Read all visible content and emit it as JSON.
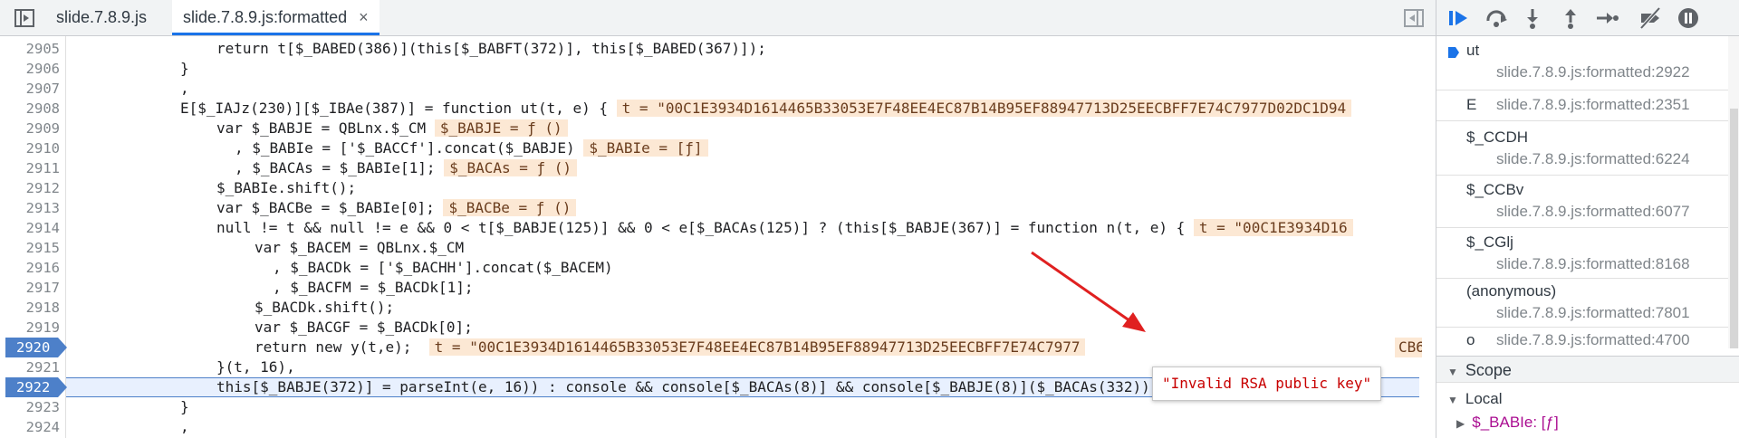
{
  "tabs": [
    {
      "label": "slide.7.8.9.js",
      "active": false
    },
    {
      "label": "slide.7.8.9.js:formatted",
      "active": true,
      "close": "×"
    }
  ],
  "icons": {
    "sidebar_toggle": "sidebar-toggle-icon",
    "panel_toggle": "panel-toggle-icon"
  },
  "code_lines": [
    {
      "no": "2905",
      "text": "return t[$_BABED(386)](this[$_BABFT(372)], this[$_BABED(367)]);"
    },
    {
      "no": "2906",
      "text": "}"
    },
    {
      "no": "2907",
      "text": ","
    },
    {
      "no": "2908",
      "text": "E[$_IAJz(230)][$_IBAe(387)] = function ut(t, e) {"
    },
    {
      "no": "2909",
      "text": "var $_BABJE = QBLnx.$_CM"
    },
    {
      "no": "2910",
      "text": ", $_BABIe = ['$_BACCf'].concat($_BABJE)"
    },
    {
      "no": "2911",
      "text": ", $_BACAs = $_BABIe[1];"
    },
    {
      "no": "2912",
      "text": "$_BABIe.shift();"
    },
    {
      "no": "2913",
      "text": "var $_BACBe = $_BABIe[0];"
    },
    {
      "no": "2914",
      "text": "null != t && null != e && 0 < t[$_BABJE(125)] && 0 < e[$_BACAs(125)] ? (this[$_BABJE(367)] = function n(t, e) {"
    },
    {
      "no": "2915",
      "text": "var $_BACEM = QBLnx.$_CM"
    },
    {
      "no": "2916",
      "text": ", $_BACDk = ['$_BACHH'].concat($_BACEM)"
    },
    {
      "no": "2917",
      "text": ", $_BACFM = $_BACDk[1];"
    },
    {
      "no": "2918",
      "text": "$_BACDk.shift();"
    },
    {
      "no": "2919",
      "text": "var $_BACGF = $_BACDk[0];"
    },
    {
      "no": "2920",
      "text": "return new y(t,e);"
    },
    {
      "no": "2921",
      "text": "}(t, 16),"
    },
    {
      "no": "2922",
      "text": "this[$_BABJE(372)] = parseInt(e, 16)) : console && console[$_BACAs(8)] && console[$_BABJE(8)]($_BACAs(332));"
    },
    {
      "no": "2923",
      "text": "}"
    },
    {
      "no": "2924",
      "text": ","
    }
  ],
  "inline_values": {
    "l2908": "t = \"00C1E3934D1614465B33053E7F48EE4EC87B14B95EF88947713D25EECBFF7E74C7977D02DC1D94",
    "l2909": "$_BABJE = ƒ ()",
    "l2910": "$_BABIe = [ƒ]",
    "l2911": "$_BACAs = ƒ ()",
    "l2913": "$_BACBe = ƒ ()",
    "l2914": "t = \"00C1E3934D16",
    "l2920": "t = \"00C1E3934D1614465B33053E7F48EE4EC87B14B95EF88947713D25EECBFF7E74C7977",
    "l2920_tail": "CB6"
  },
  "tooltip": "\"Invalid RSA public key\"",
  "breakpoints": [
    "2920",
    "2922"
  ],
  "current_line": "2922",
  "call_stack": [
    {
      "name": "ut",
      "location": "slide.7.8.9.js:formatted:2922",
      "current": true
    },
    {
      "name": "E",
      "location": "slide.7.8.9.js:formatted:2351",
      "current": false
    },
    {
      "name": "$_CCDH",
      "location": "slide.7.8.9.js:formatted:6224",
      "current": false
    },
    {
      "name": "$_CCBv",
      "location": "slide.7.8.9.js:formatted:6077",
      "current": false
    },
    {
      "name": "$_CGlj",
      "location": "slide.7.8.9.js:formatted:8168",
      "current": false
    },
    {
      "name": "(anonymous)",
      "location": "slide.7.8.9.js:formatted:7801",
      "current": false
    },
    {
      "name": "o",
      "location": "slide.7.8.9.js:formatted:4700",
      "current": false
    }
  ],
  "scope": {
    "title": "Scope",
    "local_label": "Local",
    "first_var": "$_BABIe: [ƒ]"
  },
  "debugger_buttons": [
    "resume-icon",
    "step-over-icon",
    "step-into-icon",
    "step-out-icon",
    "step-icon",
    "deactivate-breakpoints-icon",
    "pause-on-exceptions-icon"
  ],
  "colors": {
    "accent": "#1a73e8",
    "keyword": "#aa0d91",
    "variable": "#1c00cf",
    "string": "#c80000",
    "inline_value_bg": "#fce8d4",
    "breakpoint": "#4d80c9"
  }
}
